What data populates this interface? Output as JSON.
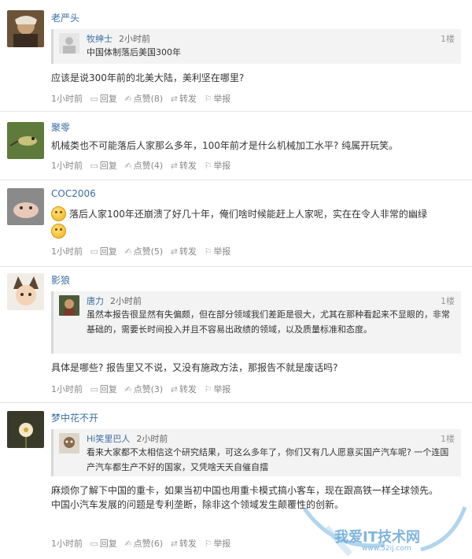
{
  "comments": [
    {
      "name": "老严头",
      "quote": {
        "name": "牧绅士",
        "time": "2小时前",
        "floor": "1楼",
        "text": "中国体制落后美国300年"
      },
      "body": "应该是说300年前的北美大陆，美利坚在哪里?",
      "actions": {
        "time": "1小时前",
        "reply": "回复",
        "like": "点赞",
        "like_count": "(8)",
        "share": "转发",
        "report": "举报"
      }
    },
    {
      "name": "聚零",
      "body": "机械类也不可能落后人家那么多年，100年前才是什么机械加工水平? 纯属开玩笑。",
      "actions": {
        "time": "1小时前",
        "reply": "回复",
        "like": "点赞",
        "like_count": "(4)",
        "share": "转发",
        "report": "举报"
      }
    },
    {
      "name": "COC2006",
      "body": "落后人家100年还崩溃了好几十年，俺们啥时候能赶上人家呢，实在在令人非常的幽绿",
      "actions": {
        "time": "1小时前",
        "reply": "回复",
        "like": "点赞",
        "like_count": "(5)",
        "share": "转发",
        "report": "举报"
      }
    },
    {
      "name": "影狼",
      "quote": {
        "name": "唐力",
        "time": "2小时前",
        "floor": "1楼",
        "text": "虽然本报告很显然有失偏颇，但在部分领域我们差距是很大，尤其在那种看起来不显眼的，非常基础的，需要长时间投入并且不容易出政绩的领域，以及质量标准和态度。"
      },
      "body": "具体是哪些? 报告里又不说，又没有施政方法，那报告不就是废话吗?",
      "actions": {
        "time": "1小时前",
        "reply": "回复",
        "like": "点赞",
        "like_count": "(3)",
        "share": "转发",
        "report": "举报"
      }
    },
    {
      "name": "梦中花不开",
      "quote": {
        "name": "Hi笑里巴人",
        "time": "2小时前",
        "floor": "1楼",
        "text": "看来大家都不太相信这个研究结果，可这么多年了，你们又有几人愿意买国产汽车呢? 一个连国产汽车都生产不好的国家，又凭啥天天自催自擂"
      },
      "body": "麻烦你了解下中国的重卡，如果当初中国也用重卡模式搞小客车，现在跟高铁一样全球领先。\n中国小汽车发展的问题是专利垄断，除非这个领域发生颠覆性的创新。",
      "actions": {
        "time": "1小时前",
        "reply": "回复",
        "like": "点赞",
        "like_count": "(6)",
        "share": "转发",
        "report": "举报"
      }
    }
  ],
  "watermark": {
    "text": "我爱IT技术网",
    "url": "www.52ij.com"
  }
}
